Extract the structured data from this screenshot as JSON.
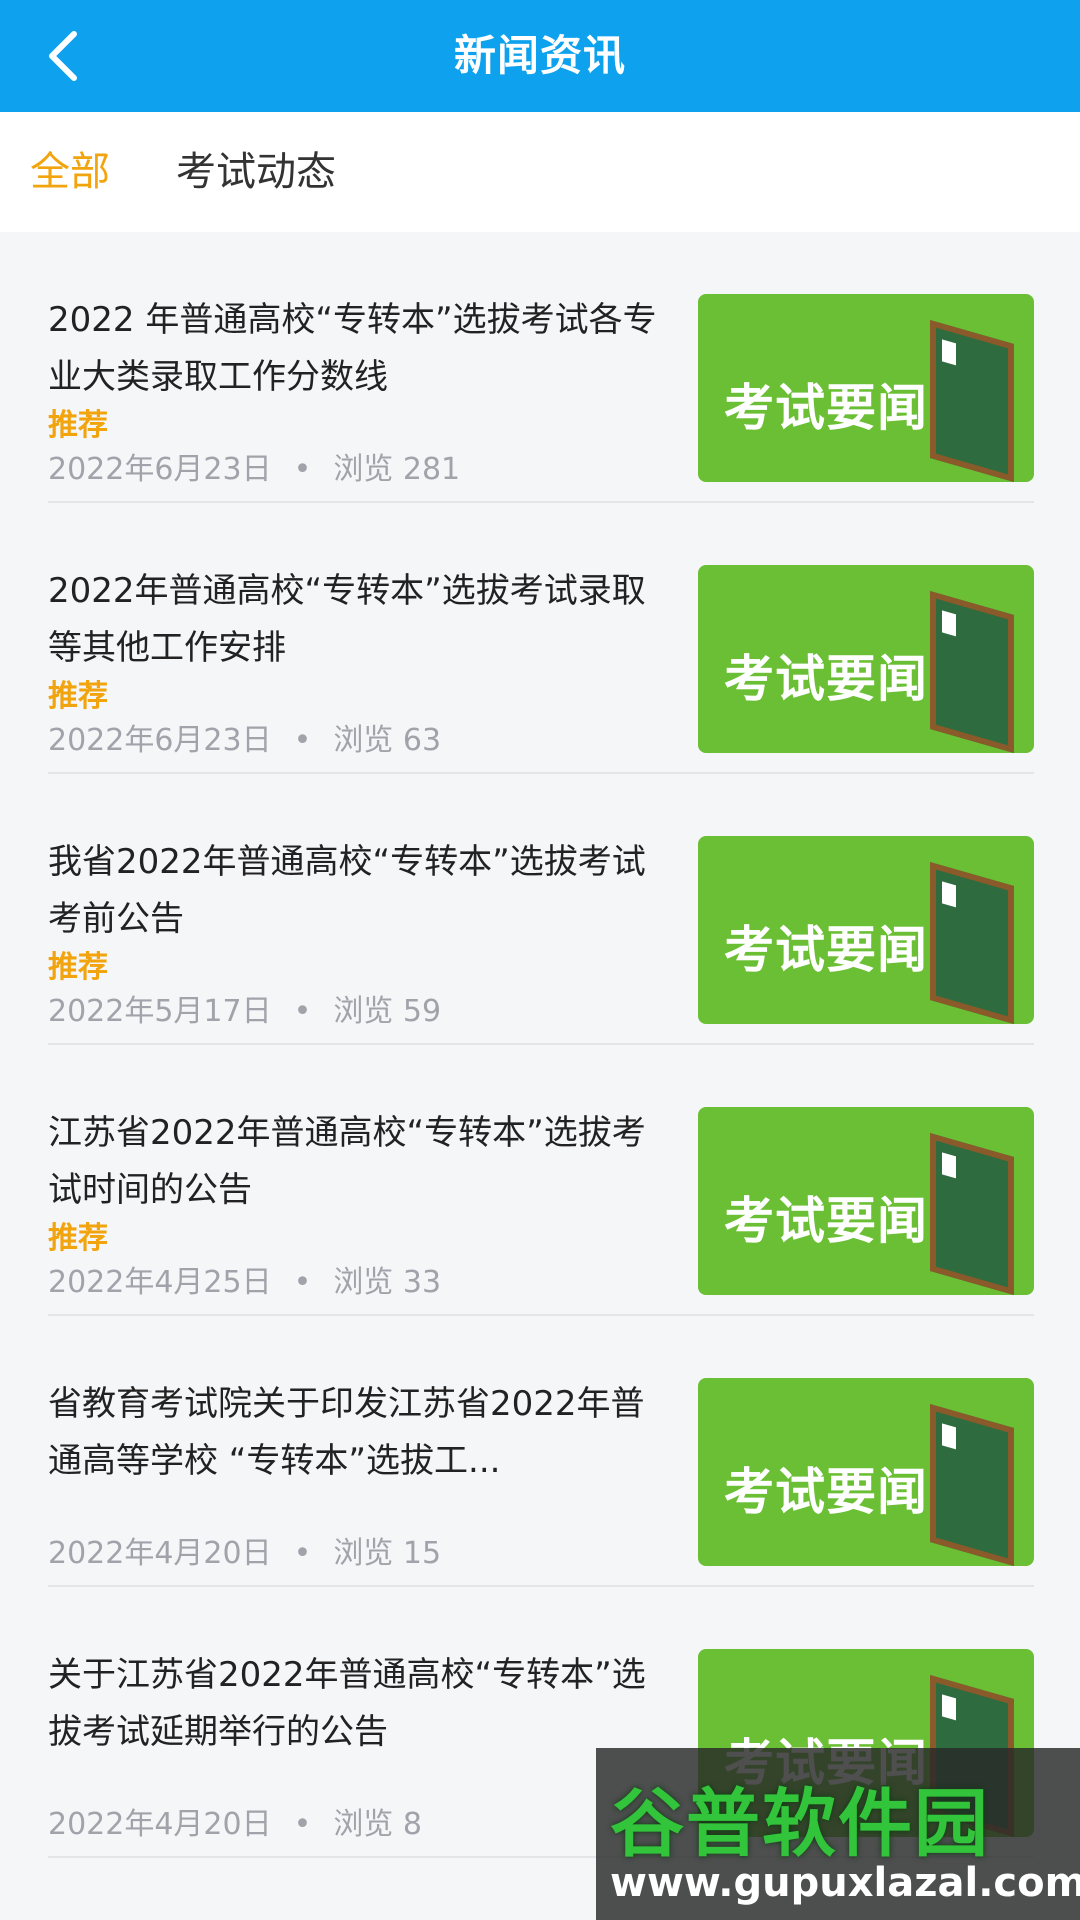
{
  "header": {
    "title": "新闻资讯",
    "back_icon": "chevron-left-icon"
  },
  "tabs": [
    {
      "label": "全部",
      "active": true
    },
    {
      "label": "考试动态",
      "active": false
    }
  ],
  "colors": {
    "header_bg": "#0ea2ee",
    "accent": "#f2a40e",
    "thumb_bg": "#6bbf34"
  },
  "news": [
    {
      "title": "2022 年普通高校“专转本”选拔考试各专业大类录取工作分数线",
      "tag": "推荐",
      "date": "2022年6月23日",
      "views_label": "浏览",
      "views": "281",
      "thumb_text": "考试要闻"
    },
    {
      "title": "2022年普通高校“专转本”选拔考试录取等其他工作安排",
      "tag": "推荐",
      "date": "2022年6月23日",
      "views_label": "浏览",
      "views": "63",
      "thumb_text": "考试要闻"
    },
    {
      "title": "我省2022年普通高校“专转本”选拔考试考前公告",
      "tag": "推荐",
      "date": "2022年5月17日",
      "views_label": "浏览",
      "views": "59",
      "thumb_text": "考试要闻"
    },
    {
      "title": "江苏省2022年普通高校“专转本”选拔考试时间的公告",
      "tag": "推荐",
      "date": "2022年4月25日",
      "views_label": "浏览",
      "views": "33",
      "thumb_text": "考试要闻"
    },
    {
      "title": "省教育考试院关于印发江苏省2022年普通高等学校 “专转本”选拔工...",
      "tag": "",
      "date": "2022年4月20日",
      "views_label": "浏览",
      "views": "15",
      "thumb_text": "考试要闻"
    },
    {
      "title": "关于江苏省2022年普通高校“专转本”选拔考试延期举行的公告",
      "tag": "",
      "date": "2022年4月20日",
      "views_label": "浏览",
      "views": "8",
      "thumb_text": "考试要闻"
    }
  ],
  "watermark": {
    "name": "谷普软件园",
    "url": "www.gupuxlazal.com"
  }
}
